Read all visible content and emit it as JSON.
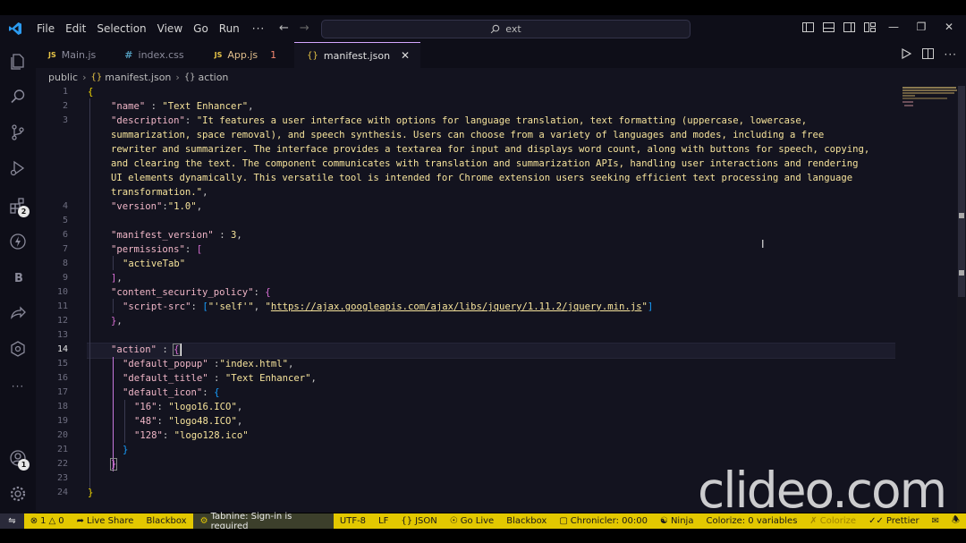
{
  "titlebar": {
    "menu": [
      "File",
      "Edit",
      "Selection",
      "View",
      "Go",
      "Run"
    ],
    "more": "···",
    "search_text": "ext"
  },
  "tabs": [
    {
      "icon": "JS",
      "label": "Main.js",
      "state": "normal"
    },
    {
      "icon": "#",
      "label": "index.css",
      "state": "normal"
    },
    {
      "icon": "JS",
      "label": "App.js",
      "state": "modified",
      "problems": "1"
    },
    {
      "icon": "{}",
      "label": "manifest.json",
      "state": "active"
    }
  ],
  "breadcrumb": {
    "folder": "public",
    "file": "manifest.json",
    "symbol": "action"
  },
  "activity_badges": {
    "extensions": "2",
    "accounts": "1"
  },
  "editor": {
    "line_numbers": [
      "1",
      "2",
      "3",
      "",
      "",
      "",
      "",
      "",
      "4",
      "5",
      "6",
      "7",
      "8",
      "9",
      "10",
      "11",
      "12",
      "13",
      "14",
      "15",
      "16",
      "17",
      "18",
      "19",
      "20",
      "21",
      "22",
      "23",
      "24"
    ],
    "active_line": "14",
    "code": {
      "l1": "{",
      "l2_key": "\"name\"",
      "l2_val": "\"Text Enhancer\"",
      "l3_key": "\"description\"",
      "l3_a": "\"It features a user interface with options for language translation, text formatting (uppercase, lowercase,",
      "l3_b": "summarization, space removal), and speech synthesis. Users can choose from a variety of languages and modes, including a free",
      "l3_c": "rewriter and summarizer. The interface provides a textarea for input and displays word count, along with buttons for speech, copying,",
      "l3_d": "and clearing the text. The component communicates with translation and summarization APIs, handling user interactions and rendering",
      "l3_e": "UI elements dynamically. This versatile tool is intended for Chrome extension users seeking efficient text processing and language",
      "l3_f": "transformation.\"",
      "l4_key": "\"version\"",
      "l4_val": "\"1.0\"",
      "l6_key": "\"manifest_version\"",
      "l6_val": "3",
      "l7_key": "\"permissions\"",
      "l8_val": "\"activeTab\"",
      "l10_key": "\"content_security_policy\"",
      "l11_key": "\"script-src\"",
      "l11_v1": "\"'self'\"",
      "l11_url": "https://ajax.googleapis.com/ajax/libs/jquery/1.11.2/jquery.min.js",
      "l14_key": "\"action\"",
      "l15_key": "\"default_popup\"",
      "l15_val": "\"index.html\"",
      "l16_key": "\"default_title\"",
      "l16_val": "\"Text Enhancer\"",
      "l17_key": "\"default_icon\"",
      "l18_key": "\"16\"",
      "l18_val": "\"logo16.ICO\"",
      "l19_key": "\"48\"",
      "l19_val": "\"logo48.ICO\"",
      "l20_key": "\"128\"",
      "l20_val": "\"logo128.ico\""
    }
  },
  "watermark": "clideo.com",
  "statusbar": {
    "errors": "1",
    "warnings": "0",
    "live_share": "Live Share",
    "blackbox1": "Blackbox",
    "tabnine": "Tabnine: Sign-in is required",
    "encoding": "UTF-8",
    "eol": "LF",
    "language": "JSON",
    "go_live": "Go Live",
    "blackbox2": "Blackbox",
    "chronicler": "Chronicler: 00:00",
    "ninja": "Ninja",
    "colorize": "Colorize: 0 variables",
    "colorize2": "Colorize",
    "prettier": "Prettier"
  },
  "colors": {
    "accent_status": "#e3c800",
    "editor_bg": "#13131f",
    "key": "#f0b6c7",
    "string": "#f6e39b"
  }
}
